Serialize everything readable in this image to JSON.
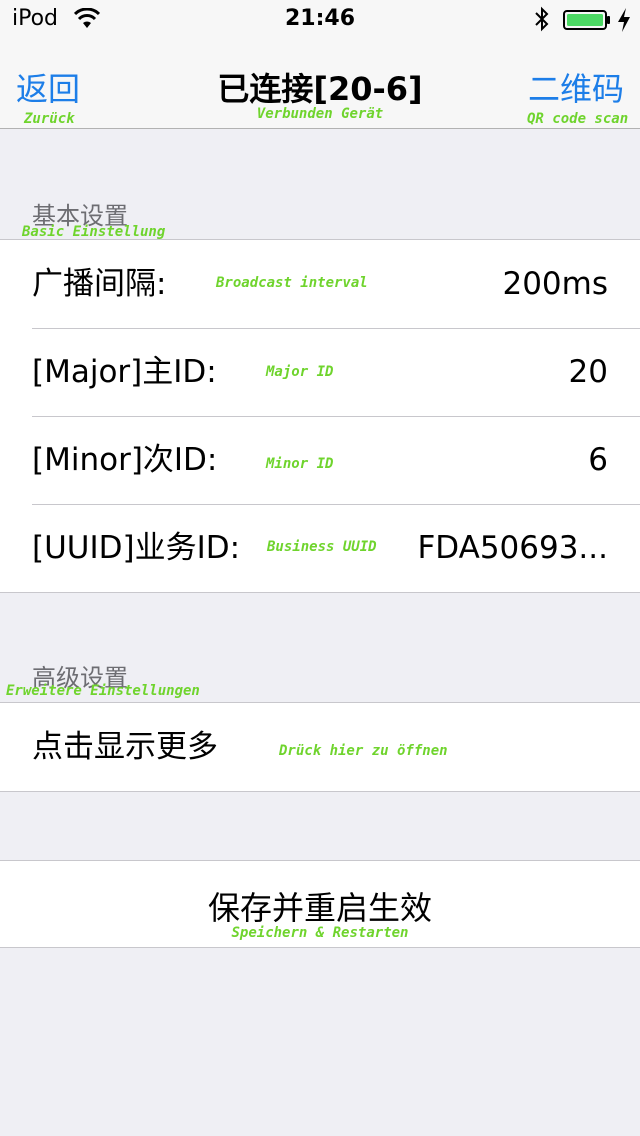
{
  "status_bar": {
    "carrier": "iPod",
    "time": "21:46"
  },
  "nav": {
    "back_label": "返回",
    "back_annotation": "Zurück",
    "title": "已连接[20-6]",
    "title_annotation": "Verbunden Gerät",
    "qr_label": "二维码",
    "qr_annotation": "QR code scan"
  },
  "basic": {
    "header": "基本设置",
    "header_annotation": "Basic Einstellung",
    "rows": [
      {
        "label": "广播间隔:",
        "annotation": "Broadcast interval",
        "value": "200ms"
      },
      {
        "label": "[Major]主ID:",
        "annotation": "Major ID",
        "value": "20"
      },
      {
        "label": "[Minor]次ID:",
        "annotation": "Minor ID",
        "value": "6"
      },
      {
        "label": "[UUID]业务ID:",
        "annotation": "Business UUID",
        "value": "FDA50693..."
      }
    ]
  },
  "advanced": {
    "header": "高级设置",
    "header_annotation": "Erweitere Einstellungen",
    "show_more_label": "点击显示更多",
    "show_more_annotation": "Drück hier zu öffnen"
  },
  "save": {
    "label": "保存并重启生效",
    "annotation": "Speichern & Restarten"
  },
  "colors": {
    "tint": "#1d7ee8",
    "annotation": "#6fd42d",
    "battery": "#4cd964"
  }
}
